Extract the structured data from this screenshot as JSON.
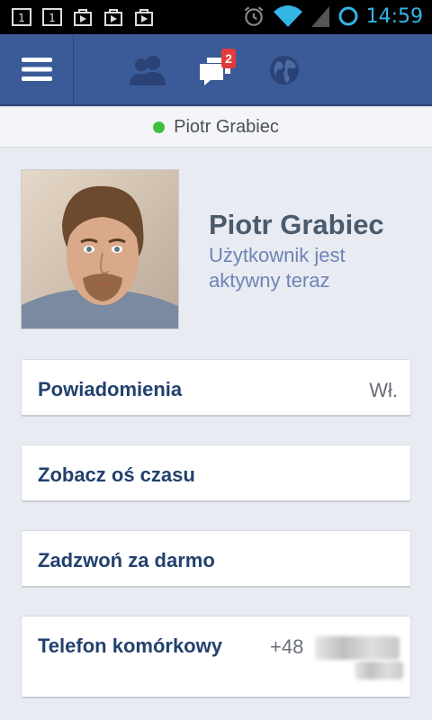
{
  "status_bar": {
    "time": "14:59",
    "left_icons": [
      "sim-1-icon",
      "sim-1-icon",
      "play-store-icon",
      "play-store-icon",
      "play-store-icon"
    ],
    "right_icons": [
      "alarm-icon",
      "wifi-icon",
      "signal-icon",
      "sync-icon"
    ]
  },
  "nav": {
    "messages_badge": "2",
    "icons": [
      "menu-icon",
      "friends-icon",
      "messages-icon",
      "globe-icon"
    ]
  },
  "presence": {
    "name": "Piotr Grabiec",
    "color": "#3fbf3f"
  },
  "profile": {
    "name": "Piotr Grabiec",
    "status": "Użytkownik jest aktywny teraz"
  },
  "cards": [
    {
      "label": "Powiadomienia",
      "value": "Wł."
    },
    {
      "label": "Zobacz oś czasu",
      "value": ""
    },
    {
      "label": "Zadzwoń za darmo",
      "value": ""
    },
    {
      "label": "Telefon komórkowy",
      "value": "+48"
    }
  ],
  "colors": {
    "brand": "#3b5b98",
    "badge": "#e23b3b",
    "card_label": "#23416e",
    "status_text": "#6d84b4"
  }
}
